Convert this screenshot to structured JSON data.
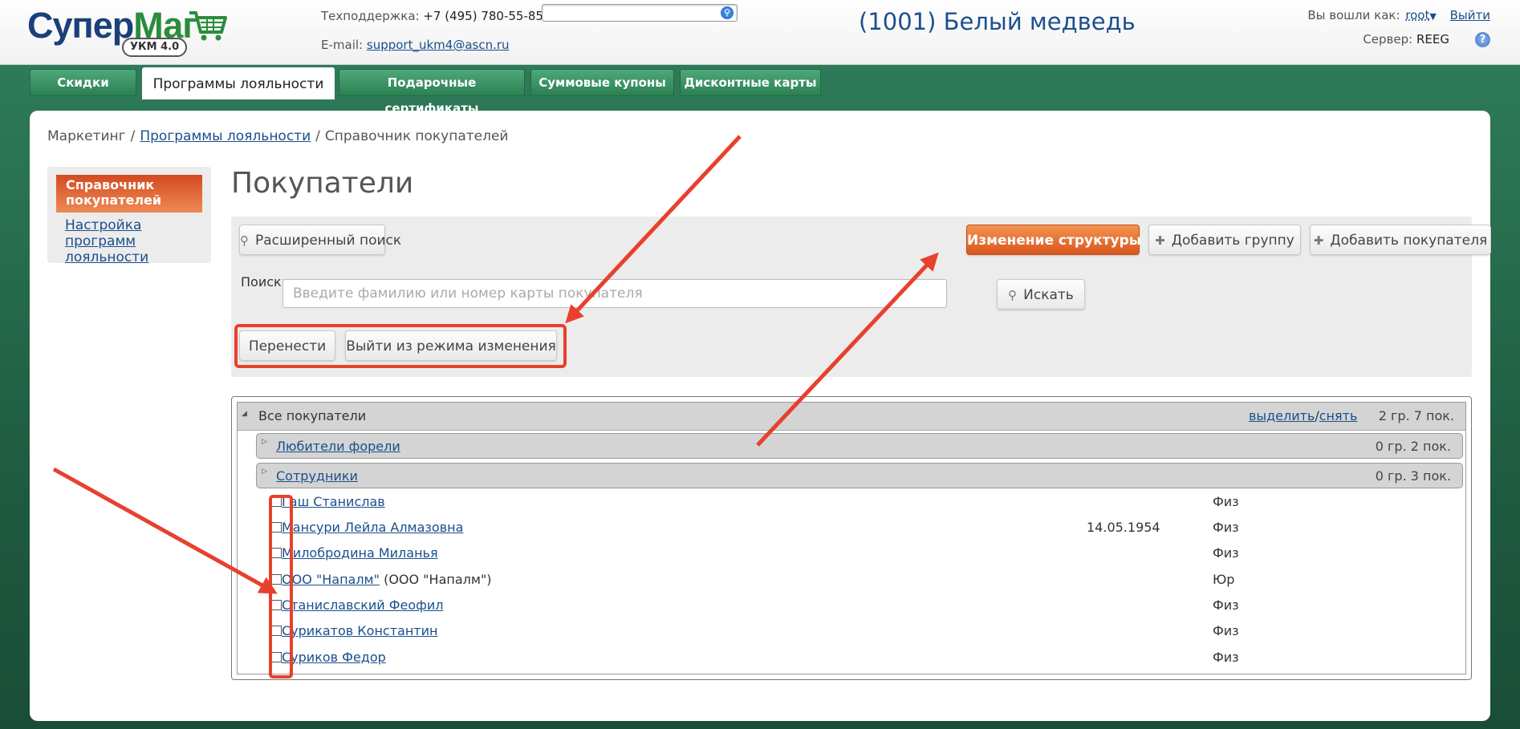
{
  "header": {
    "logo_main": "Супер",
    "logo_accent": "Маг",
    "logo_badge": "УКМ 4.0",
    "support_label": "Техподдержка:",
    "support_phone": "+7 (495) 780-55-85",
    "email_label": "E-mail:",
    "email": "support_ukm4@ascn.ru",
    "store_title": "(1001) Белый медведь",
    "logged_in_label": "Вы вошли как:",
    "user": "root",
    "logout": "Выйти",
    "server_label": "Сервер:",
    "server": "REEG",
    "help": "?"
  },
  "tabs": [
    {
      "label": "Скидки",
      "active": false
    },
    {
      "label": "Программы лояльности",
      "active": true
    },
    {
      "label": "Подарочные сертификаты",
      "active": false
    },
    {
      "label": "Суммовые купоны",
      "active": false
    },
    {
      "label": "Дисконтные карты",
      "active": false
    }
  ],
  "breadcrumb": {
    "root": "Маркетинг",
    "link": "Программы лояльности",
    "current": "Справочник покупателей",
    "separator": "/"
  },
  "sidebar": {
    "active": "Справочник покупателей",
    "link": "Настройка программ лояльности"
  },
  "page_title": "Покупатели",
  "toolbar": {
    "advanced_search": "Расширенный поиск",
    "change_structure": "Изменение структуры",
    "add_group": "Добавить группу",
    "add_customer": "Добавить покупателя",
    "search_label": "Поиск:",
    "search_placeholder": "Введите фамилию или номер карты покупателя",
    "search_button": "Искать",
    "move_button": "Перенести",
    "exit_mode_button": "Выйти из режима изменения"
  },
  "tree": {
    "root_label": "Все покупатели",
    "select_link": "выделить",
    "slash": "/",
    "deselect_link": "снять",
    "root_count": "2 гр. 7 пок.",
    "groups": [
      {
        "name": "Любители форели",
        "count": "0 гр. 2 пок."
      },
      {
        "name": "Сотрудники",
        "count": "0 гр. 3 пок."
      }
    ],
    "items": [
      {
        "name": "Гаш Станислав",
        "extra": "",
        "date": "",
        "type": "Физ"
      },
      {
        "name": "Мансури Лейла Алмазовна",
        "extra": "",
        "date": "14.05.1954",
        "type": "Физ"
      },
      {
        "name": "Милобродина Миланья",
        "extra": "",
        "date": "",
        "type": "Физ"
      },
      {
        "name": "ООО \"Напалм\"",
        "extra": " (ООО \"Напалм\")",
        "date": "",
        "type": "Юр"
      },
      {
        "name": "Станиславский Феофил",
        "extra": "",
        "date": "",
        "type": "Физ"
      },
      {
        "name": "Сурикатов Константин",
        "extra": "",
        "date": "",
        "type": "Физ"
      },
      {
        "name": "Суриков Федор",
        "extra": "",
        "date": "",
        "type": "Физ"
      }
    ]
  },
  "colors": {
    "annotation": "#e8402e",
    "brand_blue": "#1b3f7a",
    "brand_green": "#2c8c3c",
    "accent_orange": "#d9561e"
  }
}
